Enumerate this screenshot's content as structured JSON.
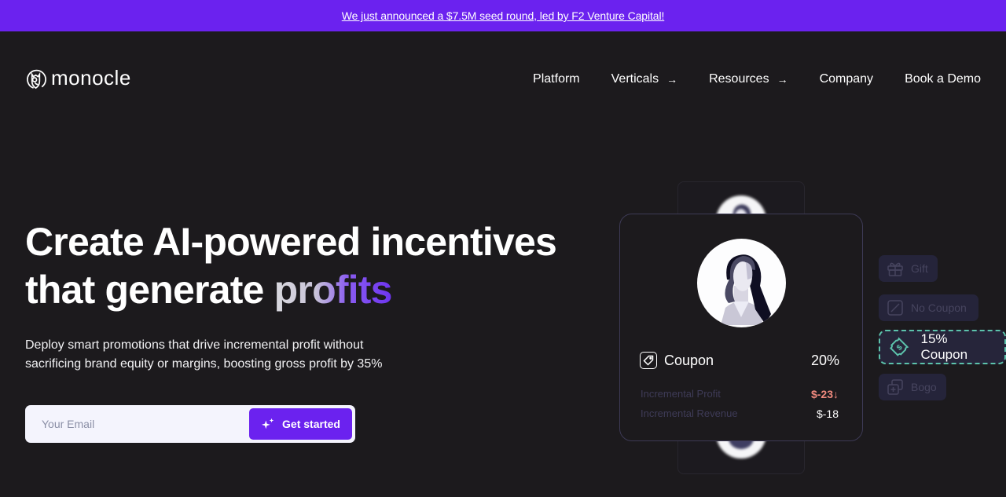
{
  "banner": {
    "text": "We just announced a $7.5M seed round, led by F2 Venture Capital!",
    "color": "#6b22ef"
  },
  "brand": {
    "name": "monocle",
    "logo_icon": "monocle-owl-icon"
  },
  "nav": {
    "items": [
      {
        "label": "Platform",
        "has_arrow": false
      },
      {
        "label": "Verticals",
        "has_arrow": true,
        "arrow": "→"
      },
      {
        "label": "Resources",
        "has_arrow": true,
        "arrow": "→"
      },
      {
        "label": "Company",
        "has_arrow": false
      },
      {
        "label": "Book a Demo",
        "has_arrow": false
      }
    ]
  },
  "hero": {
    "title_line1": "Create AI-powered incentives",
    "title_line2_prefix": "that generate ",
    "title_line2_highlight": "profits",
    "subtitle": "Deploy smart promotions that drive incremental profit without sacrificing brand equity or margins, boosting gross profit by 35%"
  },
  "signup": {
    "email_placeholder": "Your Email",
    "email_value": "",
    "cta_label": "Get started",
    "cta_icon": "sparkles-icon",
    "accent": "#6b22ef"
  },
  "offer_card": {
    "avatar": "woman-avatar",
    "incentive_icon": "tag-icon",
    "incentive_label": "Coupon",
    "incentive_value": "20%",
    "metrics": [
      {
        "label": "Incremental Profit",
        "value": "$-23↓",
        "color": "#f08a7e"
      },
      {
        "label": "Incremental Revenue",
        "value": "$-18"
      }
    ]
  },
  "incentive_options": [
    {
      "label": "Gift",
      "icon": "gift-icon",
      "active": false
    },
    {
      "label": "No Coupon",
      "icon": "no-coupon-icon",
      "active": false
    },
    {
      "label": "15% Coupon",
      "icon": "dollar-ticket-icon",
      "active": true,
      "accent": "#5cc3ac"
    },
    {
      "label": "Bogo",
      "icon": "bogo-icon",
      "active": false
    }
  ]
}
